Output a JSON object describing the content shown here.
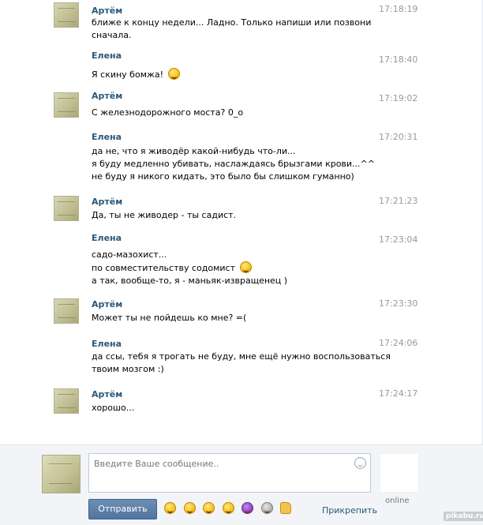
{
  "messages": [
    {
      "author": "Артём",
      "time": "17:18:19",
      "lines": [
        "ближе к концу недели... Ладно. Только напиши или позвони",
        "сначала."
      ]
    },
    {
      "author": "Елена",
      "time": "17:18:40",
      "lines": [
        "Я скину бомжа!"
      ]
    },
    {
      "author": "Артём",
      "time": "17:19:02",
      "lines": [
        "С железнодорожного моста? 0_о"
      ]
    },
    {
      "author": "Елена",
      "time": "17:20:31",
      "lines": [
        "да не, что я живодёр какой-нибудь что-ли...",
        "я буду медленно убивать, наслаждаясь брызгами крови...^^",
        "не буду я никого кидать, это было бы слишком гуманно)"
      ]
    },
    {
      "author": "Артём",
      "time": "17:21:23",
      "lines": [
        "Да, ты не живодер - ты садист."
      ]
    },
    {
      "author": "Елена",
      "time": "17:23:04",
      "lines": [
        "садо-мазохист...",
        "по совместительству содомист",
        "а так, вообще-то, я - маньяк-извращенец )"
      ]
    },
    {
      "author": "Артём",
      "time": "17:23:30",
      "lines": [
        "Может ты не пойдешь ко мне? =("
      ]
    },
    {
      "author": "Елена",
      "time": "17:24:06",
      "lines": [
        "да ссы, тебя я трогать не буду, мне ещё нужно воспользоваться",
        "твоим мозгом :)"
      ]
    },
    {
      "author": "Артём",
      "time": "17:24:17",
      "lines": [
        "хорошо..."
      ]
    }
  ],
  "composer": {
    "placeholder": "Введите Ваше сообщение..",
    "send_label": "Отправить",
    "attach_label": "Прикрепить",
    "status": "online"
  },
  "emoji_bar": [
    "laughing-emoji",
    "grin-emoji",
    "tongue-emoji",
    "blush-emoji",
    "devil-emoji",
    "scream-emoji",
    "thumbs-up-emoji"
  ],
  "watermark": "pikabu.ru",
  "colors": {
    "author": "#2b587a",
    "time": "#999999",
    "send_button": "#5b7fa8"
  }
}
